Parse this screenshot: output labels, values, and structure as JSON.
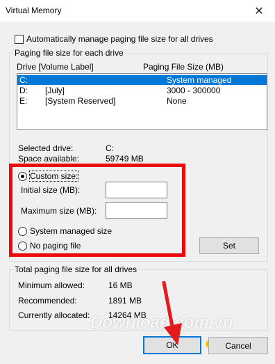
{
  "window": {
    "title": "Virtual Memory",
    "close_glyph": "✕"
  },
  "auto_manage": {
    "label": "Automatically manage paging file size for all drives",
    "checked": false
  },
  "paging_group": {
    "title": "Paging file size for each drive",
    "col_drive": "Drive  [Volume Label]",
    "col_size": "Paging File Size (MB)",
    "drives": [
      {
        "drive": "C:",
        "label": "",
        "size": "System managed",
        "selected": true
      },
      {
        "drive": "D:",
        "label": "[July]",
        "size": "3000 - 300000",
        "selected": false
      },
      {
        "drive": "E:",
        "label": "[System Reserved]",
        "size": "None",
        "selected": false
      }
    ],
    "selected_drive_label": "Selected drive:",
    "selected_drive_value": "C:",
    "space_available_label": "Space available:",
    "space_available_value": "59749 MB",
    "custom_size_label": "Custom size:",
    "initial_size_label": "Initial size (MB):",
    "initial_size_value": "",
    "maximum_size_label": "Maximum size (MB):",
    "maximum_size_value": "",
    "system_managed_label": "System managed size",
    "no_paging_label": "No paging file",
    "set_button": "Set",
    "selected_option": "custom"
  },
  "totals_group": {
    "title": "Total paging file size for all drives",
    "min_label": "Minimum allowed:",
    "min_value": "16 MB",
    "rec_label": "Recommended:",
    "rec_value": "1891 MB",
    "cur_label": "Currently allocated:",
    "cur_value": "14264 MB"
  },
  "buttons": {
    "ok": "OK",
    "cancel": "Cancel"
  },
  "watermark": {
    "text": "Download.com.vn"
  },
  "colors": {
    "highlight": "#ec0b0b",
    "selection": "#0078d7",
    "arrow": "#e31b1b"
  }
}
